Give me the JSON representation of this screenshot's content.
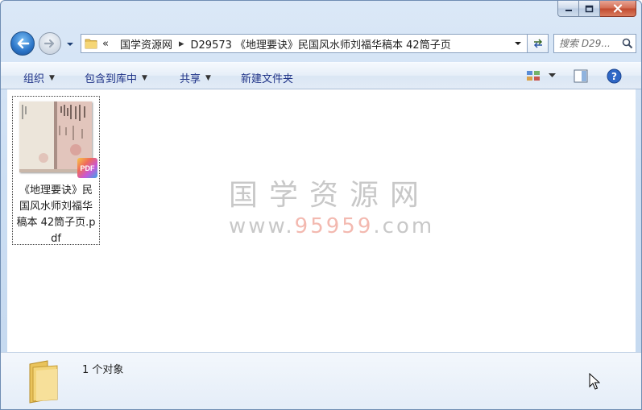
{
  "window": {
    "caption": {
      "minimize": "minimize-icon",
      "maximize": "maximize-icon",
      "close": "close-icon"
    }
  },
  "nav": {
    "overflow": "«",
    "breadcrumb": [
      "国学资源网",
      "D29573 《地理要诀》民国风水师刘福华稿本 42筒子页"
    ],
    "separator": "▸"
  },
  "search": {
    "placeholder": "搜索 D29..."
  },
  "toolbar": {
    "organize": "组织",
    "include_library": "包含到库中",
    "share": "共享",
    "new_folder": "新建文件夹"
  },
  "watermark": {
    "title": "国学资源网",
    "url_prefix": "www.",
    "url_highlight": "95959",
    "url_suffix": ".com"
  },
  "files": [
    {
      "name": "《地理要诀》民国风水师刘福华稿本 42筒子页.pdf",
      "badge": "PDF"
    }
  ],
  "details": {
    "count": "1 个对象"
  },
  "colors": {
    "accent": "#2a74c7",
    "command_text": "#1e3287",
    "watermark": "#c8c8c8"
  }
}
